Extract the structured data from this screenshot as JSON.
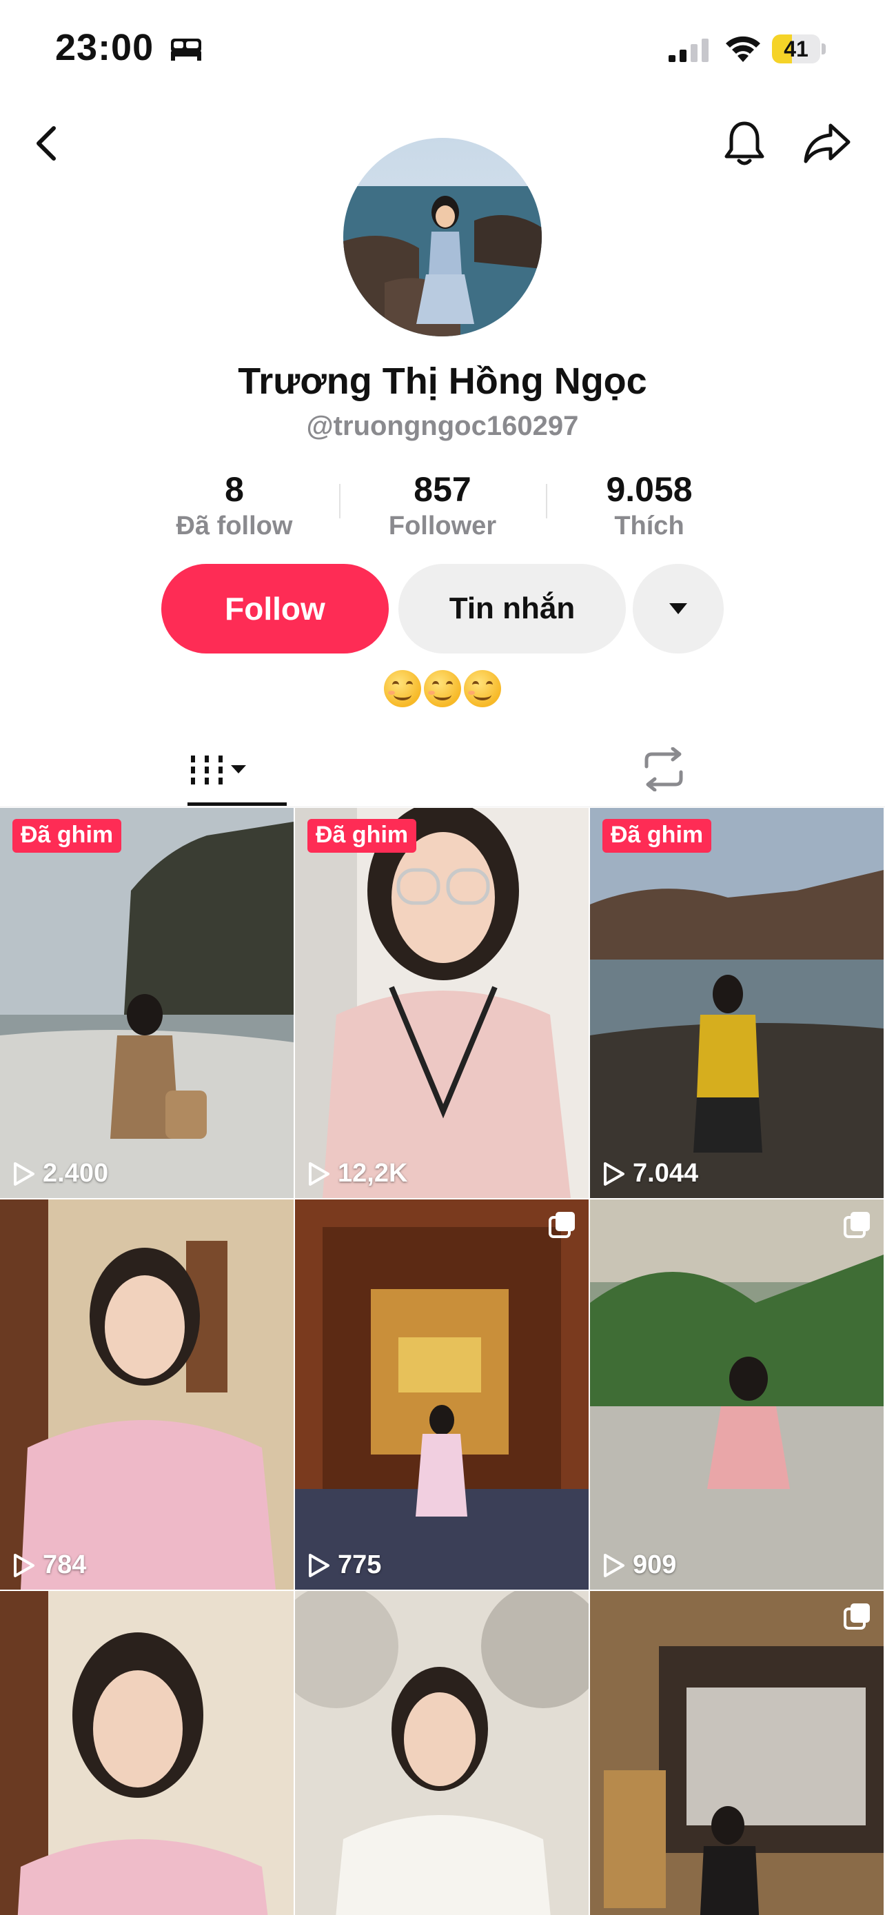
{
  "status_bar": {
    "time": "23:00",
    "battery_level": "41",
    "battery_fraction": 0.41
  },
  "profile": {
    "display_name": "Trương Thị Hồng Ngọc",
    "username": "@truongngoc160297",
    "bio_emojis": [
      "😊",
      "😊",
      "😊"
    ]
  },
  "stats": [
    {
      "value": "8",
      "label": "Đã follow"
    },
    {
      "value": "857",
      "label": "Follower"
    },
    {
      "value": "9.058",
      "label": "Thích"
    }
  ],
  "actions": {
    "follow_label": "Follow",
    "message_label": "Tin nhắn"
  },
  "tabs": [
    {
      "name": "videos-tab",
      "icon": "grid-bars-icon",
      "active": true
    },
    {
      "name": "reposts-tab",
      "icon": "repost-icon",
      "active": false
    }
  ],
  "videos": [
    {
      "pinned": true,
      "pin_label": "Đã ghim",
      "views": "2.400",
      "multi": false
    },
    {
      "pinned": true,
      "pin_label": "Đã ghim",
      "views": "12,2K",
      "multi": false
    },
    {
      "pinned": true,
      "pin_label": "Đã ghim",
      "views": "7.044",
      "multi": false
    },
    {
      "pinned": false,
      "views": "784",
      "multi": false
    },
    {
      "pinned": false,
      "views": "775",
      "multi": true
    },
    {
      "pinned": false,
      "views": "909",
      "multi": true
    },
    {
      "pinned": false,
      "views": "",
      "multi": false
    },
    {
      "pinned": false,
      "views": "",
      "multi": false
    },
    {
      "pinned": false,
      "views": "",
      "multi": true
    }
  ],
  "colors": {
    "accent": "#fe2c55",
    "secondary_button": "#efefef",
    "muted_text": "#8a8a8e",
    "battery": "#f5d328"
  }
}
